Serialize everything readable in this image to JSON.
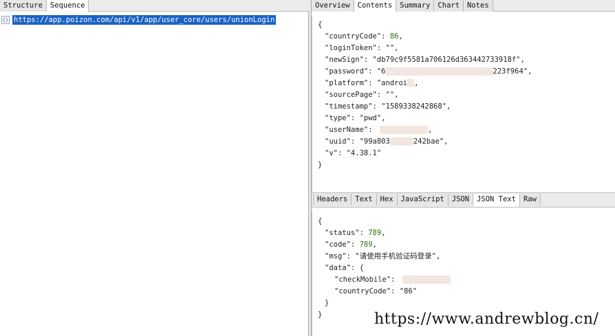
{
  "left_tabs": [
    "Structure",
    "Sequence"
  ],
  "sequence": {
    "url": "https://app.poizon.com/api/v1/app/user_core/users/unionLogin",
    "icon": "json-doc-icon",
    "icon_glyph": "{}"
  },
  "right_tabs": [
    "Overview",
    "Contents",
    "Summary",
    "Chart",
    "Notes"
  ],
  "request": {
    "open": "{",
    "close": "}",
    "fields": [
      {
        "key": "\"countryCode\": ",
        "value": "86",
        "tail": ","
      },
      {
        "key": "\"loginToken\": ",
        "value": "\"\"",
        "tail": ","
      },
      {
        "key": "\"newSign\": ",
        "value": "\"db79c9f5581a706126d363442733918f\"",
        "tail": ","
      },
      {
        "key": "\"password\": ",
        "value": "\"6",
        "blur": true,
        "value2": "223f964\"",
        "tail": ","
      },
      {
        "key": "\"platform\": ",
        "value": "\"androi",
        "blur_small": true,
        "tail": ","
      },
      {
        "key": "\"sourcePage\": ",
        "value": "\"\"",
        "tail": ","
      },
      {
        "key": "\"timestamp\": ",
        "value": "\"1589338242868\"",
        "tail": ","
      },
      {
        "key": "\"type\": ",
        "value": "\"pwd\"",
        "tail": ","
      },
      {
        "key": "\"userName\": ",
        "value": "",
        "blur_user": true,
        "tail": ","
      },
      {
        "key": "\"uuid\": ",
        "value": "\"99a803",
        "blur_mid": true,
        "value2": "242bae\"",
        "tail": ","
      },
      {
        "key": "\"v\": ",
        "value": "\"4.38.1\"",
        "tail": ""
      }
    ]
  },
  "response_tabs": [
    "Headers",
    "Text",
    "Hex",
    "JavaScript",
    "JSON",
    "JSON Text",
    "Raw"
  ],
  "response": {
    "open": "{",
    "close": "}",
    "status_key": "\"status\": ",
    "status_value": "789",
    "code_key": "\"code\": ",
    "code_value": "789",
    "msg_key": "\"msg\": ",
    "msg_value": "\"请使用手机验证码登录\"",
    "data_key": "\"data\": {",
    "checkMobile_key": "\"checkMobile\": ",
    "countryCode_key": "\"countryCode\": ",
    "countryCode_value": "\"86\"",
    "data_close": "}"
  },
  "watermark": "https://www.andrewblog.cn/"
}
